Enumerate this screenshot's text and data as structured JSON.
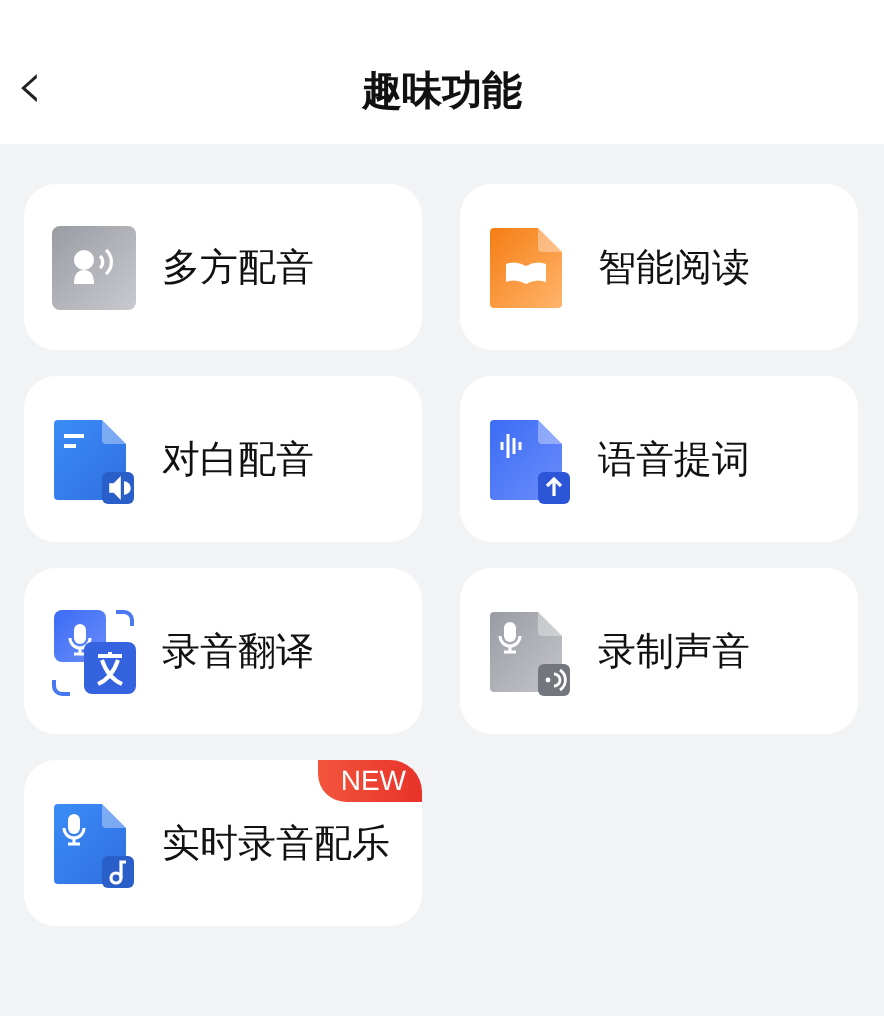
{
  "header": {
    "back": "‹",
    "title": "趣味功能"
  },
  "features": [
    {
      "label": "多方配音",
      "kind": "speaker"
    },
    {
      "label": "智能阅读",
      "kind": "book"
    },
    {
      "label": "对白配音",
      "kind": "dialogue"
    },
    {
      "label": "语音提词",
      "kind": "prompter"
    },
    {
      "label": "录音翻译",
      "kind": "translate"
    },
    {
      "label": "录制声音",
      "kind": "record"
    },
    {
      "label": "实时录音配乐",
      "kind": "music",
      "badge": "NEW"
    }
  ]
}
